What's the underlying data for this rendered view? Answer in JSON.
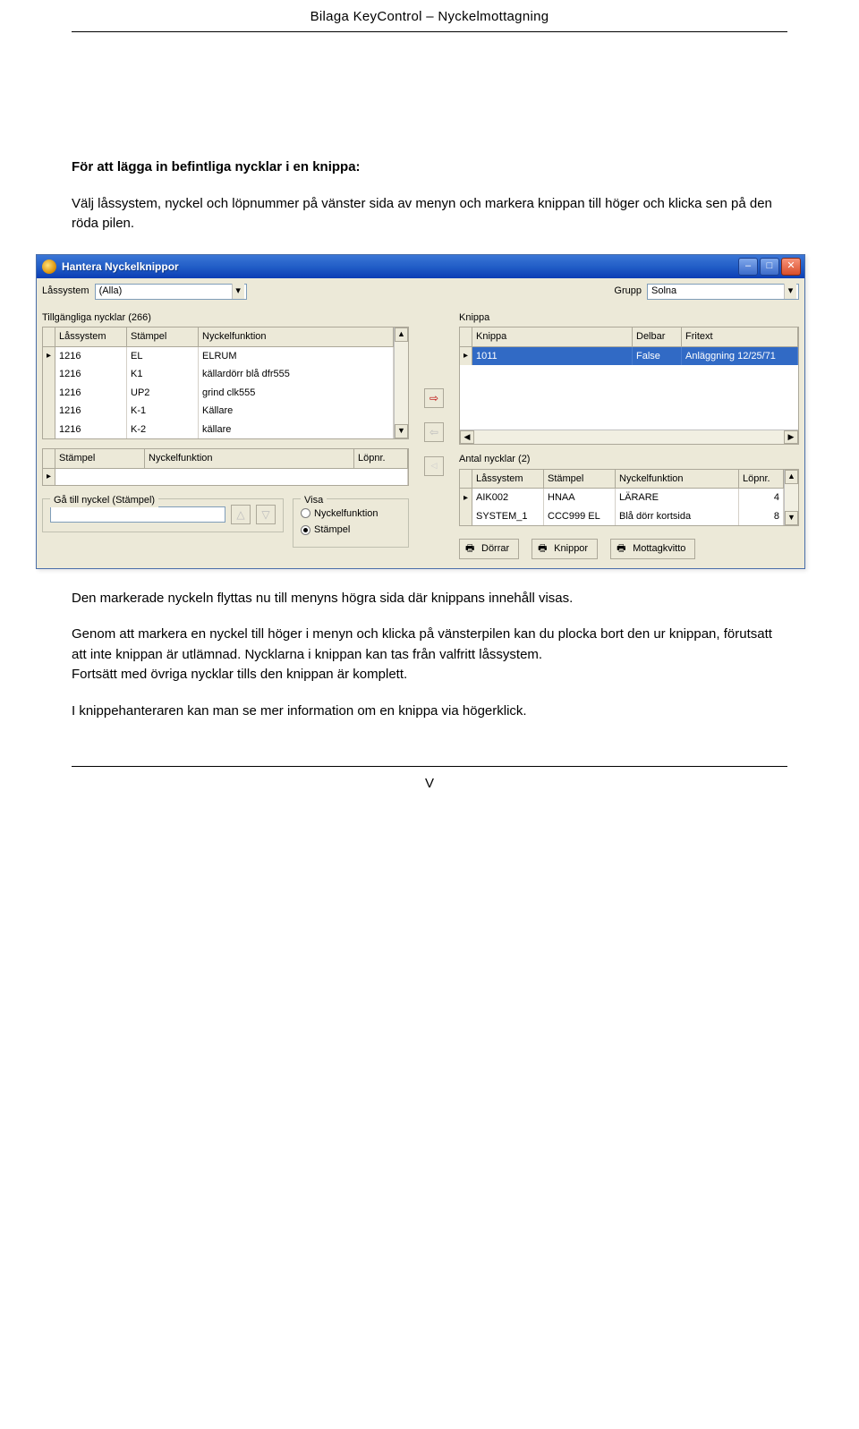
{
  "doc": {
    "header": "Bilaga KeyControl – Nyckelmottagning",
    "page_number": "V",
    "heading": "För att lägga in befintliga nycklar i en knippa:",
    "p1": "Välj låssystem, nyckel och löpnummer på vänster sida av menyn och markera knippan till höger och klicka sen på den röda pilen.",
    "p2": "Den markerade nyckeln flyttas nu till menyns högra sida där knippans innehåll visas.",
    "p3": "Genom att markera en nyckel till höger i menyn och klicka på vänsterpilen kan du plocka bort den ur knippan, förutsatt att inte knippan är utlämnad. Nycklarna i knippan kan tas från valfritt låssystem.",
    "p4": "Fortsätt med övriga nycklar tills den knippan är komplett.",
    "p5": "I knippehanteraren kan man se mer information om en knippa via högerklick."
  },
  "win": {
    "title": "Hantera Nyckelknippor",
    "left": {
      "lbl_lassystem": "Låssystem",
      "combo_lassystem": "(Alla)",
      "counter": "Tillgängliga nycklar (266)",
      "hdr": [
        "Låssystem",
        "Stämpel",
        "Nyckelfunktion"
      ],
      "rows": [
        [
          "1216",
          "EL",
          "ELRUM"
        ],
        [
          "1216",
          "K1",
          "källardörr blå dfr555"
        ],
        [
          "1216",
          "UP2",
          "grind clk555"
        ],
        [
          "1216",
          "K-1",
          "Källare"
        ],
        [
          "1216",
          "K-2",
          "källare"
        ]
      ],
      "hdr2": [
        "Stämpel",
        "Nyckelfunktion",
        "Löpnr."
      ],
      "goto_lbl": "Gå till nyckel (Stämpel)",
      "visa_legend": "Visa",
      "radio1": "Nyckelfunktion",
      "radio2": "Stämpel"
    },
    "right": {
      "lbl_grupp": "Grupp",
      "combo_grupp": "Solna",
      "lbl_knippa": "Knippa",
      "hdr": [
        "Knippa",
        "Delbar",
        "Fritext"
      ],
      "rows": [
        [
          "1011",
          "False",
          "Anläggning 12/25/71"
        ]
      ],
      "count_lbl": "Antal nycklar (2)",
      "hdr2": [
        "Låssystem",
        "Stämpel",
        "Nyckelfunktion",
        "Löpnr."
      ],
      "rows2": [
        [
          "AIK002",
          "HNAA",
          "LÄRARE",
          "4"
        ],
        [
          "SYSTEM_1",
          "CCC999 EL",
          "Blå dörr kortsida",
          "8"
        ]
      ],
      "btn_dorrar": "Dörrar",
      "btn_knippor": "Knippor",
      "btn_mottag": "Mottagkvitto"
    }
  }
}
